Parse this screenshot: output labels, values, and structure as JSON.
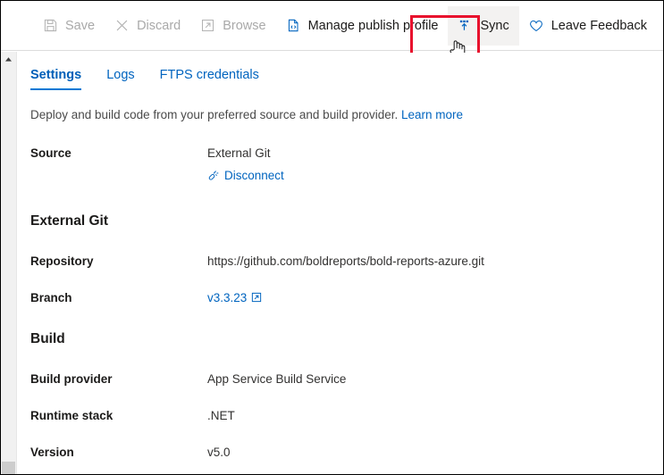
{
  "toolbar": {
    "items": [
      {
        "label": "Save",
        "icon": "save-icon",
        "state": "disabled"
      },
      {
        "label": "Discard",
        "icon": "discard-x-icon",
        "state": "disabled"
      },
      {
        "label": "Browse",
        "icon": "browse-external-icon",
        "state": "disabled"
      },
      {
        "label": "Manage publish profile",
        "icon": "publish-profile-icon",
        "state": "enabled"
      },
      {
        "label": "Sync",
        "icon": "sync-upload-icon",
        "state": "highlighted"
      },
      {
        "label": "Leave Feedback",
        "icon": "heart-icon",
        "state": "enabled"
      }
    ],
    "highlight_color": "#e8112d",
    "accent_color": "#0078d4"
  },
  "tabs": [
    {
      "label": "Settings",
      "active": true
    },
    {
      "label": "Logs",
      "active": false
    },
    {
      "label": "FTPS credentials",
      "active": false
    }
  ],
  "description": {
    "text": "Deploy and build code from your preferred source and build provider.",
    "link_label": "Learn more"
  },
  "source": {
    "label": "Source",
    "value": "External Git",
    "action_label": "Disconnect",
    "action_icon": "broken-link-icon"
  },
  "external_git": {
    "heading": "External Git",
    "rows": [
      {
        "label": "Repository",
        "value": "https://github.com/boldreports/bold-reports-azure.git",
        "link": false
      },
      {
        "label": "Branch",
        "value": "v3.3.23",
        "link": true,
        "icon": "external-link-icon"
      }
    ]
  },
  "build": {
    "heading": "Build",
    "rows": [
      {
        "label": "Build provider",
        "value": "App Service Build Service"
      },
      {
        "label": "Runtime stack",
        "value": ".NET"
      },
      {
        "label": "Version",
        "value": "v5.0"
      }
    ]
  },
  "cursor": {
    "icon": "pointing-hand-cursor"
  },
  "scrollbar": {
    "icon": "scroll-up-arrow-icon"
  }
}
